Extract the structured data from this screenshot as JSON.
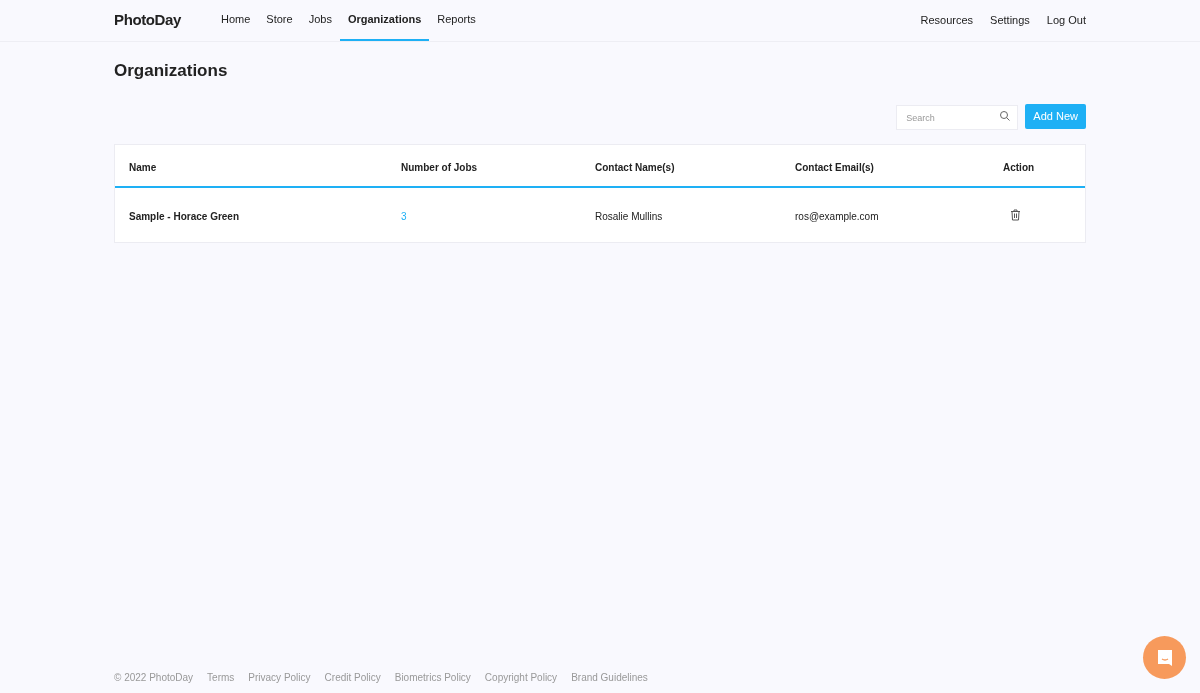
{
  "logo": "PhotoDay",
  "nav": [
    {
      "label": "Home",
      "selected": false
    },
    {
      "label": "Store",
      "selected": false
    },
    {
      "label": "Jobs",
      "selected": false
    },
    {
      "label": "Organizations",
      "selected": true
    },
    {
      "label": "Reports",
      "selected": false
    }
  ],
  "nav_right": [
    "Resources",
    "Settings",
    "Log Out"
  ],
  "page_title": "Organizations",
  "search": {
    "placeholder": "Search"
  },
  "add_button": "Add New",
  "table": {
    "columns": [
      "Name",
      "Number of Jobs",
      "Contact Name(s)",
      "Contact Email(s)",
      "Action"
    ],
    "rows": [
      {
        "name": "Sample - Horace Green",
        "jobs": "3",
        "contact": "Rosalie Mullins",
        "email": "ros@example.com"
      }
    ]
  },
  "footer": [
    "© 2022 PhotoDay",
    "Terms",
    "Privacy Policy",
    "Credit Policy",
    "Biometrics Policy",
    "Copyright Policy",
    "Brand Guidelines"
  ]
}
